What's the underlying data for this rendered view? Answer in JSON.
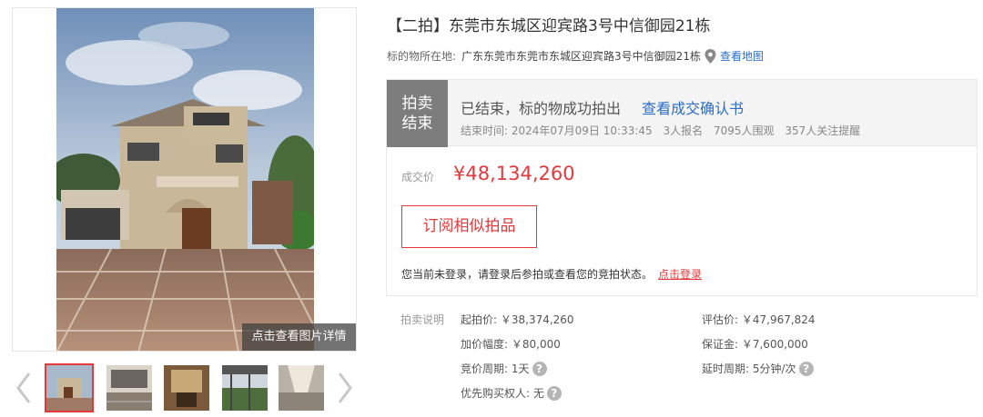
{
  "gallery": {
    "caption": "点击查看图片详情",
    "thumbnails": [
      {
        "name": "villa-exterior"
      },
      {
        "name": "interior-hall"
      },
      {
        "name": "interior-room"
      },
      {
        "name": "balcony-view"
      },
      {
        "name": "interior-corridor"
      }
    ],
    "active_index": 0
  },
  "listing": {
    "title": "【二拍】东莞市东城区迎宾路3号中信御园21栋",
    "location_label": "标的物所在地:",
    "location_address": "广东东莞市东莞市东城区迎宾路3号中信御园21栋",
    "map_link": "查看地图"
  },
  "status": {
    "tag_line1": "拍卖",
    "tag_line2": "结束",
    "message": "已结束，标的物成功拍出",
    "cert_link": "查看成交确认书",
    "end_time": "结束时间:  2024年07月09日 10:33:45",
    "signups": "3人报名",
    "viewers": "7095人围观",
    "reminders": "357人关注提醒"
  },
  "deal": {
    "label": "成交价",
    "price": "¥48,134,260",
    "subscribe_button": "订阅相似拍品",
    "login_note": "您当前未登录，请登录后参拍或查看您的竞拍状态。",
    "login_link": "点击登录"
  },
  "rules": {
    "label": "拍卖说明",
    "start_price": "起拍价: ￥38,374,260",
    "appraisal": "评估价: ￥47,967,824",
    "increment": "加价幅度: ￥80,000",
    "deposit": "保证金: ￥7,600,000",
    "bid_period": "竞价周期: 1天",
    "extension": "延时周期: 5分钟/次",
    "priority": "优先购买权人: 无"
  },
  "colors": {
    "accent_red": "#e4393c",
    "link_blue": "#2b6dc7",
    "status_gray": "#7d7d7d"
  }
}
